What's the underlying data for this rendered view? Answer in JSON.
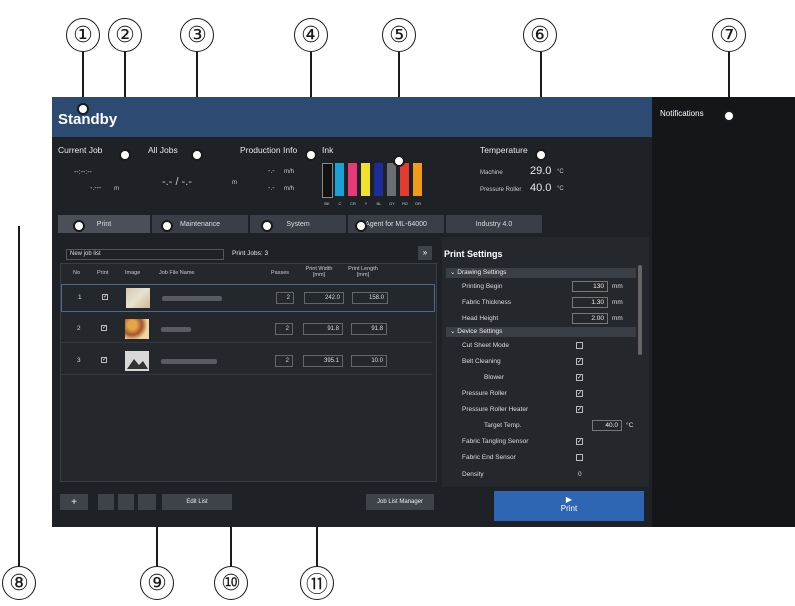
{
  "callouts": [
    "①",
    "②",
    "③",
    "④",
    "⑤",
    "⑥",
    "⑦",
    "⑧",
    "⑨",
    "⑩",
    "⑪"
  ],
  "status": {
    "title": "Standby"
  },
  "notifications": {
    "title": "Notifications"
  },
  "current_job": {
    "label": "Current Job",
    "time": "--:--:--",
    "length": "-.---",
    "unit": "m"
  },
  "all_jobs": {
    "label": "All Jobs",
    "value": "-.- / -.-",
    "unit": "m"
  },
  "production": {
    "label": "Production Info",
    "speed1": "-.-",
    "unit1": "m/h",
    "speed2": "-.-",
    "unit2": "m/h"
  },
  "ink": {
    "label": "Ink",
    "colors": [
      {
        "name": "BK",
        "color": "#111111"
      },
      {
        "name": "C",
        "color": "#19a2d8"
      },
      {
        "name": "CR",
        "color": "#e8387a"
      },
      {
        "name": "Y",
        "color": "#f1e12a"
      },
      {
        "name": "BL",
        "color": "#1e2c9b"
      },
      {
        "name": "GY",
        "color": "#6b6e73"
      },
      {
        "name": "RD",
        "color": "#e23b30"
      },
      {
        "name": "OR",
        "color": "#f39a1a"
      }
    ]
  },
  "temperature": {
    "label": "Temperature",
    "machine_label": "Machine",
    "machine_value": "29.0",
    "roller_label": "Pressure Roller",
    "roller_value": "40.0",
    "unit": "°C"
  },
  "tabs": [
    "Print",
    "Maintenance",
    "System",
    "Agent for ML-64000",
    "Industry 4.0"
  ],
  "job_list": {
    "selector": "New job list",
    "print_jobs": "Print Jobs: 3",
    "headers": [
      "No",
      "Print",
      "Image",
      "Job File Name",
      "Passes",
      "Print Width [mm]",
      "Print Length [mm]"
    ],
    "rows": [
      {
        "no": "1",
        "passes": "2",
        "width": "242.0",
        "length": "158.0"
      },
      {
        "no": "2",
        "passes": "2",
        "width": "91.8",
        "length": "91.8"
      },
      {
        "no": "3",
        "passes": "2",
        "width": "395.1",
        "length": "10.0"
      }
    ]
  },
  "settings": {
    "title": "Print Settings",
    "sections": [
      "Drawing Settings",
      "Device Settings"
    ],
    "printing_begin": {
      "label": "Printing Begin",
      "value": "130",
      "unit": "mm"
    },
    "fabric_thickness": {
      "label": "Fabric Thickness",
      "value": "1.30",
      "unit": "mm"
    },
    "head_height": {
      "label": "Head Height",
      "value": "2.00",
      "unit": "mm"
    },
    "cut_sheet": "Cut Sheet Mode",
    "belt_cleaning": "Belt Cleaning",
    "blower": "Blower",
    "pressure_roller": "Pressure Roller",
    "pressure_roller_heater": "Pressure Roller Heater",
    "target_temp": {
      "label": "Target Temp.",
      "value": "40.0",
      "unit": "°C"
    },
    "fabric_tangling": "Fabric Tangling Sensor",
    "fabric_end": "Fabric End Sensor",
    "density": {
      "label": "Density",
      "value": "0"
    }
  },
  "buttons": {
    "add": "+",
    "edit_list": "Edit List",
    "job_list_manager": "Job List Manager",
    "print": "Print",
    "expand": "»"
  }
}
